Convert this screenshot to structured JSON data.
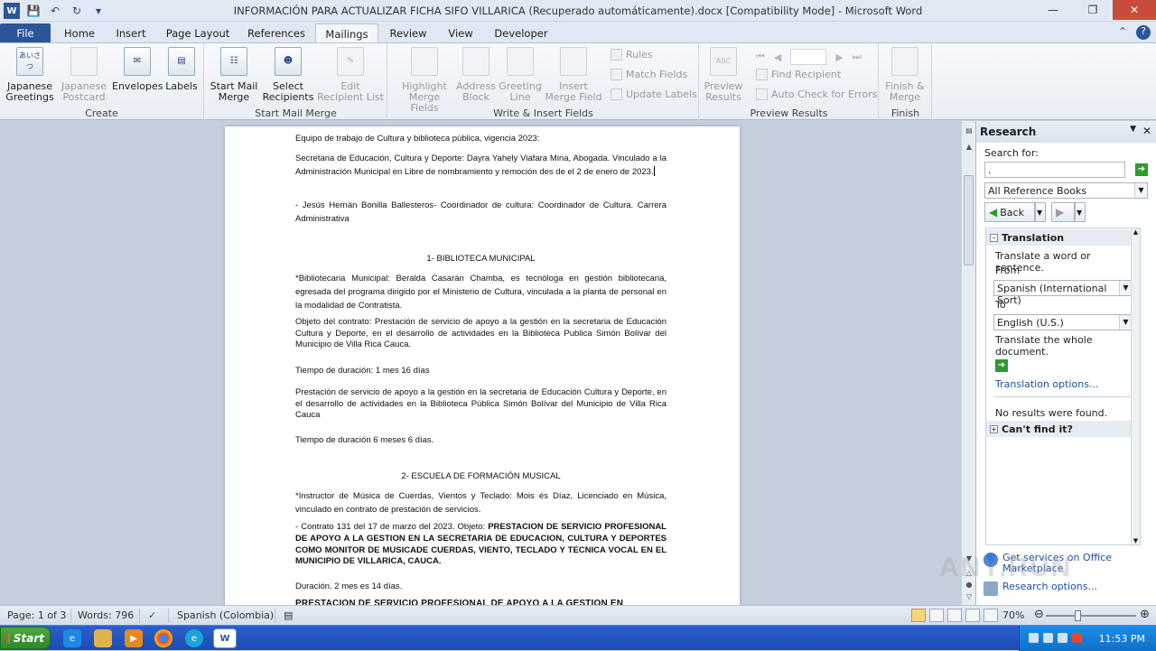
{
  "window": {
    "title": "INFORMACIÓN PARA ACTUALIZAR FICHA SIFO VILLARICA (Recuperado automáticamente).docx [Compatibility Mode] - Microsoft Word"
  },
  "tabs": [
    "File",
    "Home",
    "Insert",
    "Page Layout",
    "References",
    "Mailings",
    "Review",
    "View",
    "Developer"
  ],
  "ribbon": {
    "create": {
      "label": "Create",
      "japanese_greetings": "Japanese Greetings",
      "japanese_postcard": "Japanese Postcard",
      "envelopes": "Envelopes",
      "labels": "Labels",
      "jg_icon": "あいさつ"
    },
    "start_mail_merge": {
      "label": "Start Mail Merge",
      "start": "Start Mail Merge",
      "select": "Select Recipients",
      "edit": "Edit Recipient List"
    },
    "write_insert": {
      "label": "Write & Insert Fields",
      "highlight": "Highlight Merge Fields",
      "address": "Address Block",
      "greeting": "Greeting Line",
      "insert": "Insert Merge Field",
      "rules": "Rules",
      "match": "Match Fields",
      "update": "Update Labels"
    },
    "preview": {
      "label": "Preview Results",
      "preview": "Preview Results",
      "find": "Find Recipient",
      "auto": "Auto Check for Errors",
      "abc": "ABC"
    },
    "finish": {
      "label": "Finish",
      "finish": "Finish & Merge"
    }
  },
  "document": {
    "p1": "Equipo de trabajo de Cultura y biblioteca pública, vigencia 2023:",
    "p2": "Secretaria de Educación, Cultura y Deporte: Dayra Yahely Viafara Mina, Abogada. Vinculado a la Administración Municipal en Libre de nombramiento y remoción des de el 2 de enero de 2023.",
    "p3": "- Jesús Hernán Bonilla Ballesteros- Coordinador de cultura: Coordinador de Cultura. Carrera Administrativa",
    "h1": "1- BIBLIOTECA MUNICIPAL",
    "p4": "*Bibliotecaria Municipal: Beralda Casarán Chamba, es tecnóloga en gestión bibliotecaria, egresada del programa dirigido por el Ministerio de Cultura, vinculada a la planta de personal en la modalidad de Contratista.",
    "p5": "Objeto del contrato: Prestación de servicio de apoyo a la gestión en la secretaria de Educación Cultura y Deporte, en el desarrollo de actividades en la Biblioteca Publica Simón Bolívar del Municipio de Villa Rica Cauca.",
    "p6": "Tiempo de duración:  1 mes 16 días",
    "p7": "Prestación de servicio de apoyo a la gestión en la secretaria de Educación Cultura y Deporte, en el desarrollo de actividades en la Biblioteca Pública Simón Bolívar del Municipio de Villa Rica Cauca",
    "p8": "Tiempo de duración 6 meses 6 días.",
    "h2": "2- ESCUELA DE FORMACIÓN MUSICAL",
    "p9": "*Instructor de Música de Cuerdas, Vientos y Teclado: Mois és Díaz, Licenciado en Música, vinculado en contrato de prestación de servicios.",
    "p10a": "- Contrato 131 del 17 de marzo del 2023. Objeto: ",
    "p10b": "PRESTACION DE SERVICIO PROFESIONAL DE APOYO A LA GESTION EN LA SECRETARIA DE EDUCACION, CULTURA Y DEPORTES COMO MONITOR DE MUSICADE CUERDAS, VIENTO, TECLADO Y TECNICA VOCAL EN EL MUNICIPIO DE VILLARICA, CAUCA.",
    "p11": "Duración. 2 mes es 14 días.",
    "p12": "PRESTACION DE SERVICIO PROFESIONAL DE APOYO A LA GESTION EN"
  },
  "research": {
    "title": "Research",
    "search_for": "Search for:",
    "search_value": ".",
    "source": "All Reference Books",
    "back": "Back",
    "translation": "Translation",
    "translate_hint": "Translate a word or sentence.",
    "from": "From",
    "from_value": "Spanish (International Sort)",
    "to": "To",
    "to_value": "English (U.S.)",
    "translate_doc": "Translate the whole document.",
    "translation_options": "Translation options...",
    "no_results": "No results were found.",
    "cant_find": "Can't find it?",
    "get_services": "Get services on Office Marketplace",
    "research_options": "Research options..."
  },
  "status": {
    "page": "Page: 1 of 3",
    "words": "Words: 796",
    "language": "Spanish (Colombia)",
    "zoom": "70%"
  },
  "taskbar": {
    "start": "Start",
    "time": "11:53 PM"
  },
  "watermark": "ANY.RUN"
}
